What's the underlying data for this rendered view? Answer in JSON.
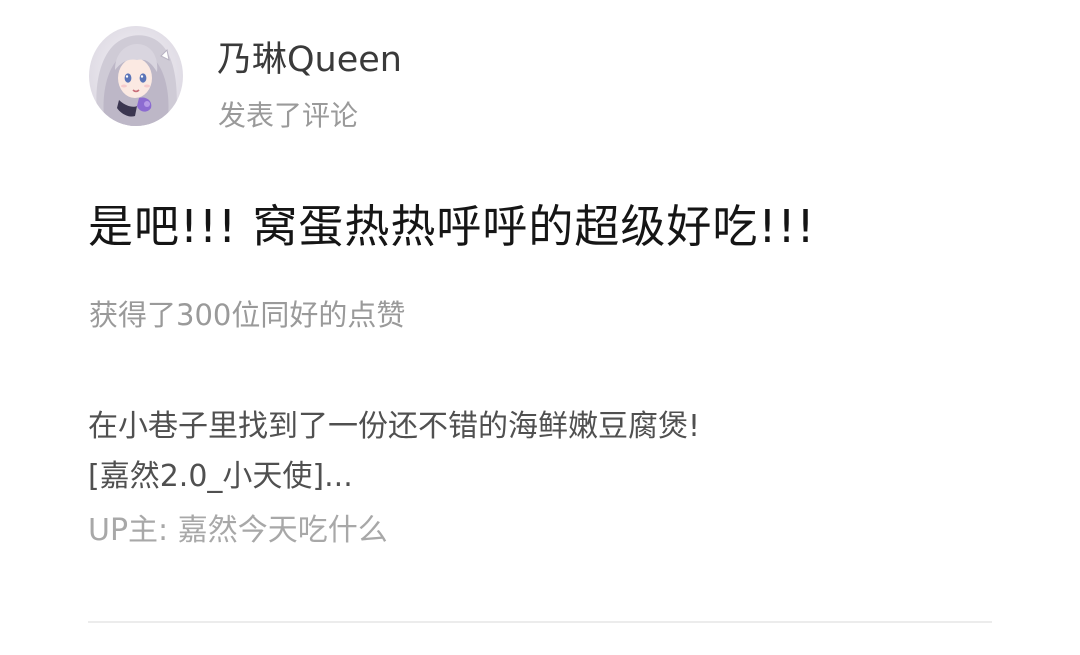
{
  "user": {
    "name": "乃琳Queen",
    "action": "发表了评论",
    "avatar_icon": "anime-girl-avatar"
  },
  "comment": {
    "text": "是吧!!! 窝蛋热热呼呼的超级好吃!!!",
    "likes_text": "获得了300位同好的点赞"
  },
  "quoted_post": {
    "line1": "在小巷子里找到了一份还不错的海鲜嫩豆腐煲!",
    "line2": "[嘉然2.0_小天使]...",
    "uploader": "UP主: 嘉然今天吃什么"
  },
  "colors": {
    "name": "#3a3a3a",
    "secondary": "#9a9a9a",
    "comment": "#151515",
    "quote": "#505050",
    "divider": "#ececec"
  }
}
